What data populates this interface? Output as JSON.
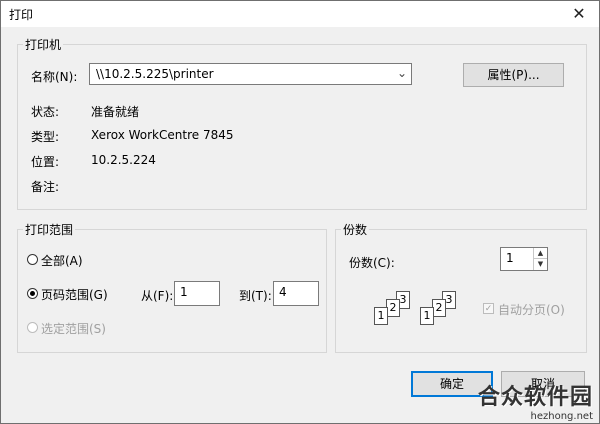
{
  "window": {
    "title": "打印",
    "close_glyph": "✕"
  },
  "printer": {
    "group_title": "打印机",
    "name_label": "名称(N):",
    "name_value": "\\\\10.2.5.225\\printer",
    "properties_button": "属性(P)...",
    "status_label": "状态:",
    "status_value": "准备就绪",
    "type_label": "类型:",
    "type_value": "Xerox WorkCentre 7845",
    "location_label": "位置:",
    "location_value": "10.2.5.224",
    "comment_label": "备注:",
    "comment_value": ""
  },
  "range": {
    "group_title": "打印范围",
    "all_label": "全部(A)",
    "pages_label": "页码范围(G)",
    "selection_label": "选定范围(S)",
    "selected": "pages",
    "from_label": "从(F):",
    "from_value": "1",
    "to_label": "到(T):",
    "to_value": "4"
  },
  "copies": {
    "group_title": "份数",
    "count_label": "份数(C):",
    "count_value": "1",
    "collate_label": "自动分页(O)",
    "collate_checked": true,
    "page_numbers": [
      "1",
      "2",
      "3"
    ]
  },
  "footer": {
    "ok_button": "确定",
    "cancel_button": "取消"
  },
  "watermark": {
    "text": "合众软件园",
    "url": "hezhong.net"
  },
  "colors": {
    "accent": "#0078d7",
    "disabled": "#a0a0a0"
  }
}
